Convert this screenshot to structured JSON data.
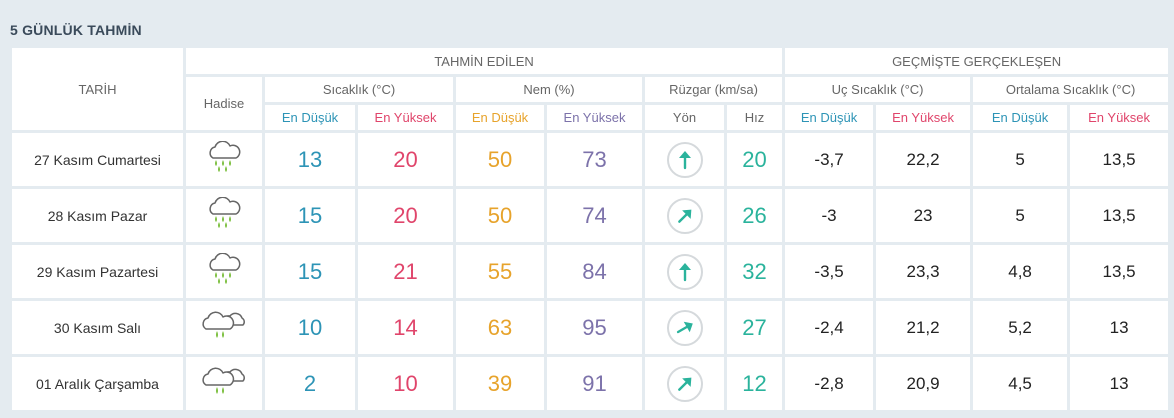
{
  "title": "5 GÜNLÜK TAHMİN",
  "headers": {
    "date": "TARİH",
    "forecast_group": "TAHMİN EDİLEN",
    "past_group": "GEÇMİŞTE GERÇEKLEŞEN",
    "event": "Hadise",
    "temperature": "Sıcaklık (°C)",
    "humidity": "Nem (%)",
    "wind": "Rüzgar (km/sa)",
    "extreme_temp": "Uç Sıcaklık (°C)",
    "avg_temp": "Ortalama Sıcaklık (°C)",
    "min": "En Düşük",
    "max": "En Yüksek",
    "direction": "Yön",
    "speed": "Hız"
  },
  "days": [
    {
      "date": "27 Kasım Cumartesi",
      "icon": "rain-cloud-icon",
      "temp_min": "13",
      "temp_max": "20",
      "hum_min": "50",
      "hum_max": "73",
      "wind_dir_deg": 0,
      "wind_speed": "20",
      "ext_min": "-3,7",
      "ext_max": "22,2",
      "avg_min": "5",
      "avg_max": "13,5"
    },
    {
      "date": "28 Kasım Pazar",
      "icon": "rain-cloud-icon",
      "temp_min": "15",
      "temp_max": "20",
      "hum_min": "50",
      "hum_max": "74",
      "wind_dir_deg": 45,
      "wind_speed": "26",
      "ext_min": "-3",
      "ext_max": "23",
      "avg_min": "5",
      "avg_max": "13,5"
    },
    {
      "date": "29 Kasım Pazartesi",
      "icon": "rain-cloud-icon",
      "temp_min": "15",
      "temp_max": "21",
      "hum_min": "55",
      "hum_max": "84",
      "wind_dir_deg": 0,
      "wind_speed": "32",
      "ext_min": "-3,5",
      "ext_max": "23,3",
      "avg_min": "4,8",
      "avg_max": "13,5"
    },
    {
      "date": "30 Kasım Salı",
      "icon": "cloudy-rain-icon",
      "temp_min": "10",
      "temp_max": "14",
      "hum_min": "63",
      "hum_max": "95",
      "wind_dir_deg": 60,
      "wind_speed": "27",
      "ext_min": "-2,4",
      "ext_max": "21,2",
      "avg_min": "5,2",
      "avg_max": "13"
    },
    {
      "date": "01 Aralık Çarşamba",
      "icon": "cloudy-rain-icon",
      "temp_min": "2",
      "temp_max": "10",
      "hum_min": "39",
      "hum_max": "91",
      "wind_dir_deg": 45,
      "wind_speed": "12",
      "ext_min": "-2,8",
      "ext_max": "20,9",
      "avg_min": "4,5",
      "avg_max": "13"
    }
  ],
  "colors": {
    "temp_min": "#2d94b6",
    "temp_max": "#e0456b",
    "hum_min": "#e7a32b",
    "hum_max": "#7c72aa",
    "wind": "#2ab39c",
    "background": "#e4ebf0"
  }
}
